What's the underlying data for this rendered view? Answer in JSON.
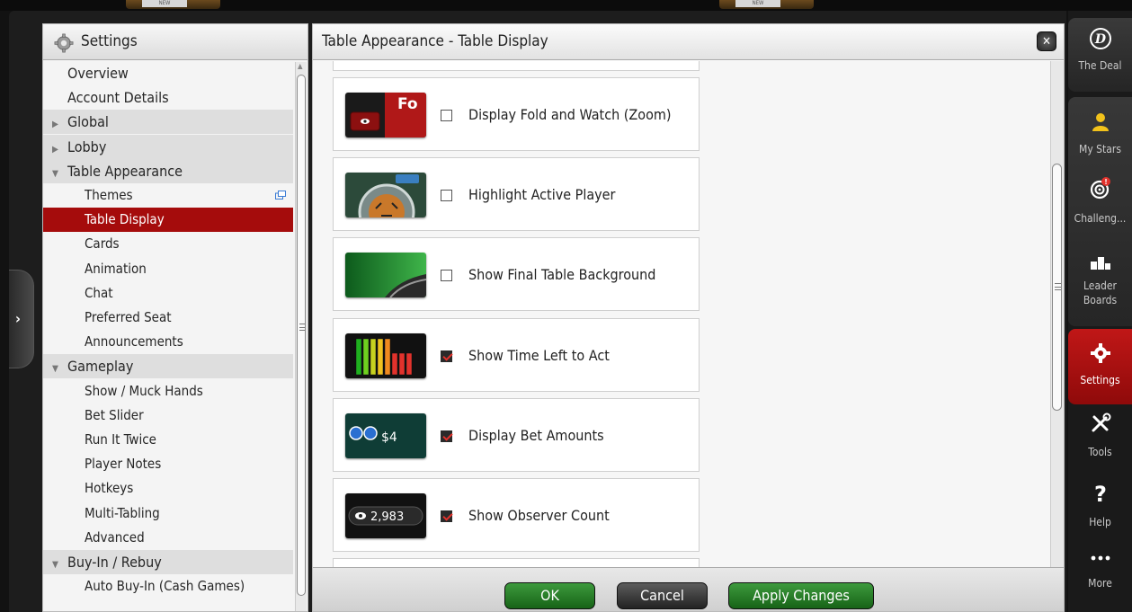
{
  "left_panel": {
    "title": "Settings",
    "nav": [
      {
        "label": "Overview",
        "kind": "top"
      },
      {
        "label": "Account Details",
        "kind": "top"
      },
      {
        "label": "Global",
        "kind": "group",
        "expanded": false
      },
      {
        "label": "Lobby",
        "kind": "group",
        "expanded": false
      },
      {
        "label": "Table Appearance",
        "kind": "group",
        "expanded": true
      },
      {
        "label": "Themes",
        "kind": "sub",
        "popout": true
      },
      {
        "label": "Table Display",
        "kind": "sub",
        "selected": true
      },
      {
        "label": "Cards",
        "kind": "sub"
      },
      {
        "label": "Animation",
        "kind": "sub"
      },
      {
        "label": "Chat",
        "kind": "sub"
      },
      {
        "label": "Preferred Seat",
        "kind": "sub"
      },
      {
        "label": "Announcements",
        "kind": "sub"
      },
      {
        "label": "Gameplay",
        "kind": "group",
        "expanded": true
      },
      {
        "label": "Show / Muck Hands",
        "kind": "sub"
      },
      {
        "label": "Bet Slider",
        "kind": "sub"
      },
      {
        "label": "Run It Twice",
        "kind": "sub"
      },
      {
        "label": "Player Notes",
        "kind": "sub"
      },
      {
        "label": "Hotkeys",
        "kind": "sub"
      },
      {
        "label": "Multi-Tabling",
        "kind": "sub"
      },
      {
        "label": "Advanced",
        "kind": "sub"
      },
      {
        "label": "Buy-In / Rebuy",
        "kind": "group",
        "expanded": true
      },
      {
        "label": "Auto Buy-In (Cash Games)",
        "kind": "sub"
      }
    ]
  },
  "main_panel": {
    "title": "Table Appearance - Table Display",
    "settings": [
      {
        "label": "Display Fold and Watch (Zoom)",
        "checked": false,
        "thumb": "fold-watch",
        "thumb_text": "Fo"
      },
      {
        "label": "Highlight Active Player",
        "checked": false,
        "thumb": "active-player"
      },
      {
        "label": "Show Final Table Background",
        "checked": false,
        "thumb": "final-table"
      },
      {
        "label": "Show Time Left to Act",
        "checked": true,
        "thumb": "time-left"
      },
      {
        "label": "Display Bet Amounts",
        "checked": true,
        "thumb": "bet-amounts",
        "thumb_text": "$4"
      },
      {
        "label": "Show Observer Count",
        "checked": true,
        "thumb": "observer-count",
        "thumb_text": "2,983"
      }
    ],
    "footer": {
      "ok_label": "OK",
      "cancel_label": "Cancel",
      "apply_label": "Apply Changes"
    }
  },
  "right_bar": {
    "items": [
      {
        "label": "The Deal",
        "icon": "the-deal-icon"
      },
      {
        "label": "My Stars",
        "icon": "my-stars-icon"
      },
      {
        "label": "Challeng...",
        "icon": "challenges-icon"
      },
      {
        "label": "Leader\nBoards",
        "label_line1": "Leader",
        "label_line2": "Boards",
        "icon": "leaderboards-icon"
      },
      {
        "label": "Settings",
        "icon": "gear-icon",
        "selected": true
      },
      {
        "label": "Tools",
        "icon": "tools-icon"
      },
      {
        "label": "Help",
        "icon": "help-icon"
      },
      {
        "label": "More",
        "icon": "more-icon"
      }
    ]
  },
  "top_strip": {
    "badge_text": "NEW"
  },
  "colors": {
    "selected_red": "#a50c0c",
    "button_green": "#1f7a1f",
    "checkbox_red": "#e2322c"
  }
}
